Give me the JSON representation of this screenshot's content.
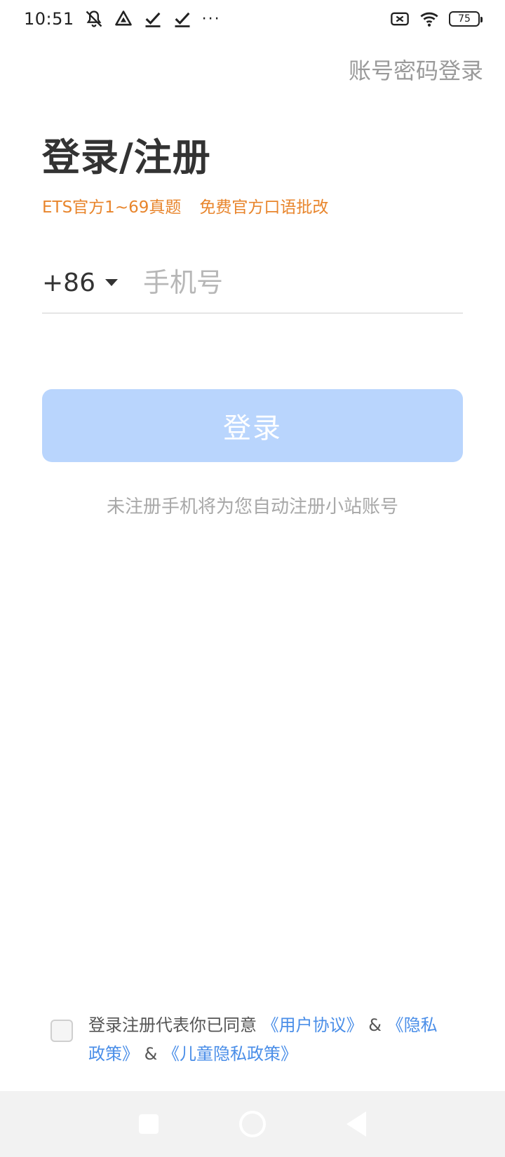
{
  "status_bar": {
    "time": "10:51",
    "battery": "75",
    "more": "···",
    "icons": [
      "mute-bell-icon",
      "drive-icon",
      "check-icon",
      "check-icon",
      "more-dots-icon",
      "no-sim-icon",
      "wifi-icon",
      "battery-icon"
    ]
  },
  "header": {
    "account_login": "账号密码登录"
  },
  "title": "登录/注册",
  "promo": {
    "item1": "ETS官方1~69真题",
    "item2": "免费官方口语批改",
    "color": "#e8852c"
  },
  "phone": {
    "country_code": "+86",
    "placeholder": "手机号",
    "value": ""
  },
  "login_button": {
    "label": "登录",
    "color": "#b9d5fd"
  },
  "hint": "未注册手机将为您自动注册小站账号",
  "agreement": {
    "prefix": "登录注册代表你已同意",
    "user_agreement": "《用户协议》",
    "amp1": "&",
    "privacy_policy": "《隐私政策》",
    "amp2": "&",
    "child_privacy_policy": "《儿童隐私政策》",
    "checked": false,
    "link_color": "#4a8ee8"
  },
  "nav": {
    "icons": [
      "recent-apps-icon",
      "home-icon",
      "back-icon"
    ]
  }
}
